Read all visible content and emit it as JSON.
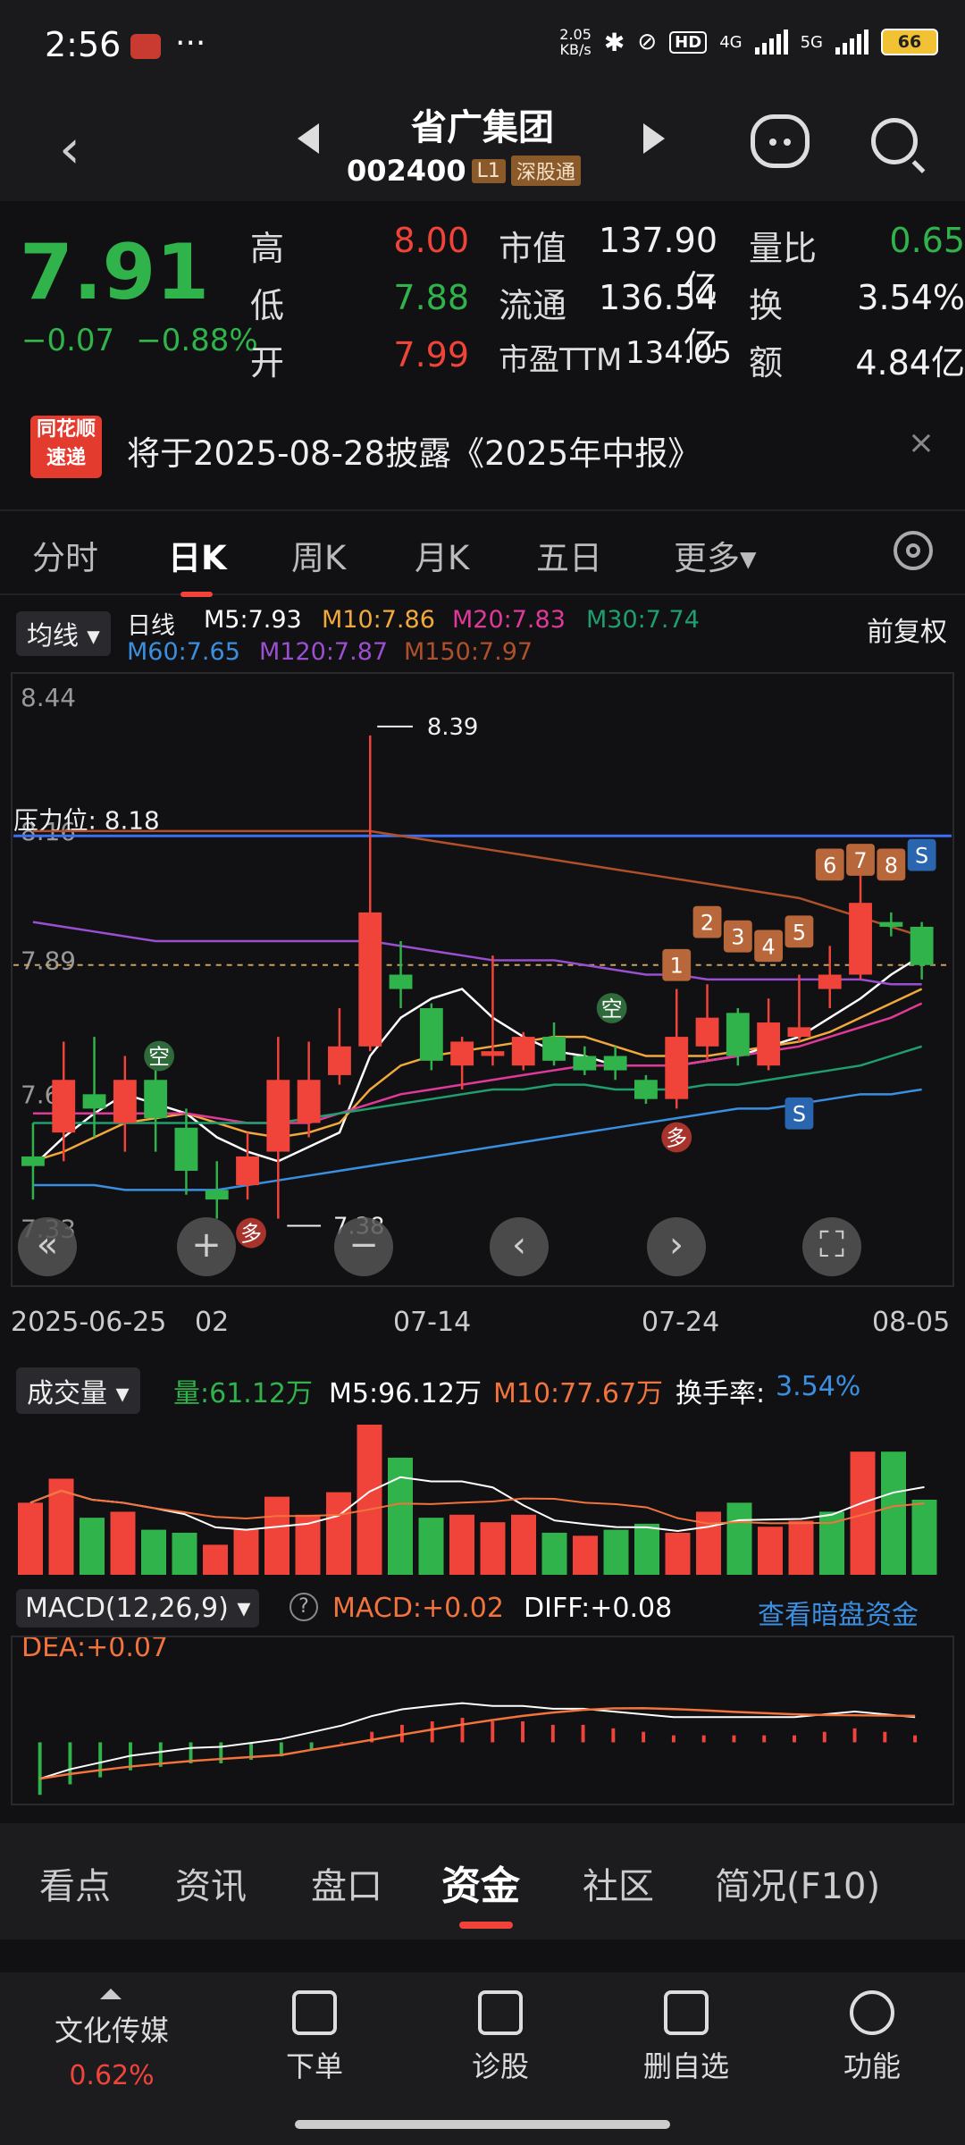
{
  "status": {
    "time": "2:56",
    "speed_top": "2.05",
    "speed_bot": "KB/s",
    "hd": "HD",
    "net1": "4G",
    "net2": "5G",
    "battery": "66"
  },
  "header": {
    "name": "省广集团",
    "code": "002400",
    "tag_l1": "L1",
    "tag_sgt": "深股通"
  },
  "quote": {
    "price": "7.91",
    "change": "−0.07",
    "change_pct": "−0.88%",
    "high_label": "高",
    "high": "8.00",
    "low_label": "低",
    "low": "7.88",
    "open_label": "开",
    "open": "7.99",
    "mcap_label": "市值",
    "mcap": "137.90亿",
    "float_label": "流通",
    "float": "136.54亿",
    "pe_label": "市盈TTM",
    "pe": "134.05",
    "vr_label": "量比",
    "vr": "0.65",
    "turn_label": "换",
    "turn": "3.54%",
    "amt_label": "额",
    "amt": "4.84亿"
  },
  "banner": {
    "logo_top": "同花顺",
    "logo_bot": "速递",
    "text": "将于2025-08-28披露《2025年中报》",
    "close": "×"
  },
  "tabs": [
    "分时",
    "日K",
    "周K",
    "月K",
    "五日",
    "更多▾"
  ],
  "ma": {
    "selector": "均线 ▾",
    "period": "日线",
    "m5": "M5:7.93",
    "m10": "M10:7.86",
    "m20": "M20:7.83",
    "m30": "M30:7.74",
    "m60": "M60:7.65",
    "m120": "M120:7.87",
    "m150": "M150:7.97",
    "adjust": "前复权",
    "colors": {
      "m5": "#ffffff",
      "m10": "#f2a93b",
      "m20": "#e0399a",
      "m30": "#1f9e6e",
      "m60": "#3b8fe0",
      "m120": "#9a4fd0",
      "m150": "#b0502a"
    }
  },
  "chart": {
    "y_labels": [
      "8.44",
      "8.16",
      "7.89",
      "7.61",
      "7.33"
    ],
    "resistance": "压力位: 8.18",
    "high_mark": "8.39",
    "low_mark": "7.38",
    "signal_kong": "空",
    "signal_duo": "多",
    "signal_s": "S",
    "counts": [
      "1",
      "2",
      "3",
      "4",
      "5",
      "6",
      "7",
      "8"
    ]
  },
  "chart_data": {
    "type": "candlestick",
    "ylim": [
      7.33,
      8.5
    ],
    "candles": [
      {
        "o": 7.51,
        "c": 7.49,
        "h": 7.58,
        "l": 7.42
      },
      {
        "o": 7.56,
        "c": 7.67,
        "h": 7.75,
        "l": 7.5
      },
      {
        "o": 7.64,
        "c": 7.61,
        "h": 7.76,
        "l": 7.55
      },
      {
        "o": 7.58,
        "c": 7.67,
        "h": 7.72,
        "l": 7.52
      },
      {
        "o": 7.67,
        "c": 7.59,
        "h": 7.7,
        "l": 7.52
      },
      {
        "o": 7.57,
        "c": 7.48,
        "h": 7.61,
        "l": 7.43
      },
      {
        "o": 7.44,
        "c": 7.42,
        "h": 7.5,
        "l": 7.38
      },
      {
        "o": 7.45,
        "c": 7.51,
        "h": 7.56,
        "l": 7.42
      },
      {
        "o": 7.52,
        "c": 7.67,
        "h": 7.76,
        "l": 7.38
      },
      {
        "o": 7.58,
        "c": 7.67,
        "h": 7.75,
        "l": 7.55
      },
      {
        "o": 7.68,
        "c": 7.74,
        "h": 7.82,
        "l": 7.66
      },
      {
        "o": 7.74,
        "c": 8.02,
        "h": 8.39,
        "l": 7.73
      },
      {
        "o": 7.89,
        "c": 7.86,
        "h": 7.96,
        "l": 7.82
      },
      {
        "o": 7.82,
        "c": 7.71,
        "h": 7.83,
        "l": 7.69
      },
      {
        "o": 7.7,
        "c": 7.75,
        "h": 7.76,
        "l": 7.65
      },
      {
        "o": 7.72,
        "c": 7.73,
        "h": 7.93,
        "l": 7.7
      },
      {
        "o": 7.7,
        "c": 7.76,
        "h": 7.77,
        "l": 7.69
      },
      {
        "o": 7.76,
        "c": 7.71,
        "h": 7.79,
        "l": 7.7
      },
      {
        "o": 7.72,
        "c": 7.69,
        "h": 7.74,
        "l": 7.68
      },
      {
        "o": 7.72,
        "c": 7.69,
        "h": 7.74,
        "l": 7.67
      },
      {
        "o": 7.67,
        "c": 7.63,
        "h": 7.68,
        "l": 7.62
      },
      {
        "o": 7.63,
        "c": 7.76,
        "h": 7.86,
        "l": 7.61
      },
      {
        "o": 7.74,
        "c": 7.8,
        "h": 7.87,
        "l": 7.71
      },
      {
        "o": 7.81,
        "c": 7.72,
        "h": 7.82,
        "l": 7.7
      },
      {
        "o": 7.7,
        "c": 7.79,
        "h": 7.84,
        "l": 7.69
      },
      {
        "o": 7.76,
        "c": 7.78,
        "h": 7.89,
        "l": 7.75
      },
      {
        "o": 7.86,
        "c": 7.89,
        "h": 7.95,
        "l": 7.82
      },
      {
        "o": 7.89,
        "c": 8.04,
        "h": 8.1,
        "l": 7.88
      },
      {
        "o": 8.0,
        "c": 7.99,
        "h": 8.02,
        "l": 7.97
      },
      {
        "o": 7.99,
        "c": 7.91,
        "h": 8.0,
        "l": 7.88
      }
    ],
    "ma_series": [
      {
        "name": "M5",
        "color": "#ffffff",
        "values": [
          7.49,
          7.55,
          7.6,
          7.64,
          7.62,
          7.6,
          7.55,
          7.52,
          7.5,
          7.53,
          7.56,
          7.72,
          7.8,
          7.84,
          7.86,
          7.8,
          7.76,
          7.73,
          7.72,
          7.7,
          7.7,
          7.7,
          7.71,
          7.72,
          7.74,
          7.76,
          7.8,
          7.84,
          7.89,
          7.93
        ]
      },
      {
        "name": "M10",
        "color": "#f2a93b",
        "values": [
          7.5,
          7.52,
          7.55,
          7.58,
          7.59,
          7.6,
          7.58,
          7.56,
          7.55,
          7.56,
          7.58,
          7.65,
          7.7,
          7.72,
          7.73,
          7.74,
          7.75,
          7.76,
          7.76,
          7.74,
          7.72,
          7.72,
          7.72,
          7.73,
          7.74,
          7.75,
          7.77,
          7.8,
          7.83,
          7.86
        ]
      },
      {
        "name": "M20",
        "color": "#e0399a",
        "values": [
          7.6,
          7.6,
          7.6,
          7.6,
          7.6,
          7.6,
          7.59,
          7.58,
          7.58,
          7.58,
          7.6,
          7.62,
          7.64,
          7.65,
          7.66,
          7.67,
          7.68,
          7.69,
          7.7,
          7.7,
          7.7,
          7.7,
          7.71,
          7.72,
          7.73,
          7.74,
          7.76,
          7.78,
          7.8,
          7.83
        ]
      },
      {
        "name": "M30",
        "color": "#1f9e6e",
        "values": [
          7.58,
          7.58,
          7.58,
          7.58,
          7.58,
          7.58,
          7.58,
          7.58,
          7.58,
          7.59,
          7.6,
          7.61,
          7.62,
          7.63,
          7.64,
          7.65,
          7.65,
          7.66,
          7.66,
          7.65,
          7.65,
          7.65,
          7.66,
          7.66,
          7.67,
          7.68,
          7.69,
          7.7,
          7.72,
          7.74
        ]
      },
      {
        "name": "M60",
        "color": "#3b8fe0",
        "values": [
          7.45,
          7.45,
          7.45,
          7.44,
          7.44,
          7.44,
          7.44,
          7.45,
          7.46,
          7.47,
          7.48,
          7.49,
          7.5,
          7.51,
          7.52,
          7.53,
          7.54,
          7.55,
          7.56,
          7.57,
          7.58,
          7.59,
          7.6,
          7.61,
          7.61,
          7.62,
          7.63,
          7.64,
          7.64,
          7.65
        ]
      },
      {
        "name": "M120",
        "color": "#9a4fd0",
        "values": [
          8.0,
          7.99,
          7.98,
          7.97,
          7.96,
          7.96,
          7.96,
          7.96,
          7.96,
          7.96,
          7.96,
          7.96,
          7.95,
          7.94,
          7.93,
          7.92,
          7.92,
          7.92,
          7.91,
          7.9,
          7.89,
          7.89,
          7.88,
          7.88,
          7.88,
          7.88,
          7.88,
          7.88,
          7.87,
          7.87
        ]
      },
      {
        "name": "M150",
        "color": "#b0502a",
        "values": [
          8.19,
          8.19,
          8.19,
          8.19,
          8.19,
          8.19,
          8.19,
          8.19,
          8.19,
          8.19,
          8.19,
          8.19,
          8.18,
          8.17,
          8.16,
          8.15,
          8.14,
          8.13,
          8.12,
          8.11,
          8.1,
          8.09,
          8.08,
          8.07,
          8.06,
          8.05,
          8.03,
          8.01,
          7.99,
          7.97
        ]
      }
    ],
    "volume": [
      48,
      64,
      38,
      42,
      30,
      28,
      20,
      30,
      52,
      40,
      55,
      100,
      78,
      38,
      40,
      35,
      40,
      28,
      26,
      30,
      34,
      28,
      42,
      48,
      32,
      36,
      42,
      82,
      82,
      50
    ],
    "vol_up": [
      true,
      true,
      false,
      true,
      false,
      false,
      true,
      true,
      true,
      true,
      true,
      true,
      false,
      false,
      true,
      true,
      true,
      false,
      true,
      false,
      false,
      true,
      true,
      false,
      true,
      true,
      false,
      true,
      false,
      false
    ],
    "macd": [
      -0.15,
      -0.12,
      -0.1,
      -0.08,
      -0.07,
      -0.06,
      -0.06,
      -0.05,
      -0.04,
      -0.02,
      0.0,
      0.03,
      0.05,
      0.06,
      0.07,
      0.06,
      0.06,
      0.05,
      0.05,
      0.04,
      0.03,
      0.02,
      0.02,
      0.02,
      0.02,
      0.02,
      0.03,
      0.04,
      0.03,
      0.02
    ],
    "x_labels": [
      "2025-06-25",
      "02",
      "07-14",
      "07-24",
      "08-05"
    ]
  },
  "controls": {
    "back": "«",
    "zoom_in": "+",
    "zoom_out": "−",
    "prev": "‹",
    "next": "›",
    "fullscreen": "⛶"
  },
  "volume_hdr": {
    "selector": "成交量 ▾",
    "vol": "量:61.12万",
    "m5": "M5:96.12万",
    "m10": "M10:77.67万",
    "turn_label": "换手率:",
    "turn": "3.54%"
  },
  "macd_hdr": {
    "selector": "MACD(12,26,9) ▾",
    "help": "?",
    "macd": "MACD:+0.02",
    "diff": "DIFF:+0.08",
    "dea": "DEA:+0.07",
    "link": "查看暗盘资金"
  },
  "bottom_tabs": [
    "看点",
    "资讯",
    "盘口",
    "资金",
    "社区",
    "简况(F10)"
  ],
  "bottombar": {
    "sector_name": "文化传媒",
    "sector_pct": "0.62%",
    "order": "下单",
    "diagnose": "诊股",
    "remove": "删自选",
    "func": "功能"
  }
}
